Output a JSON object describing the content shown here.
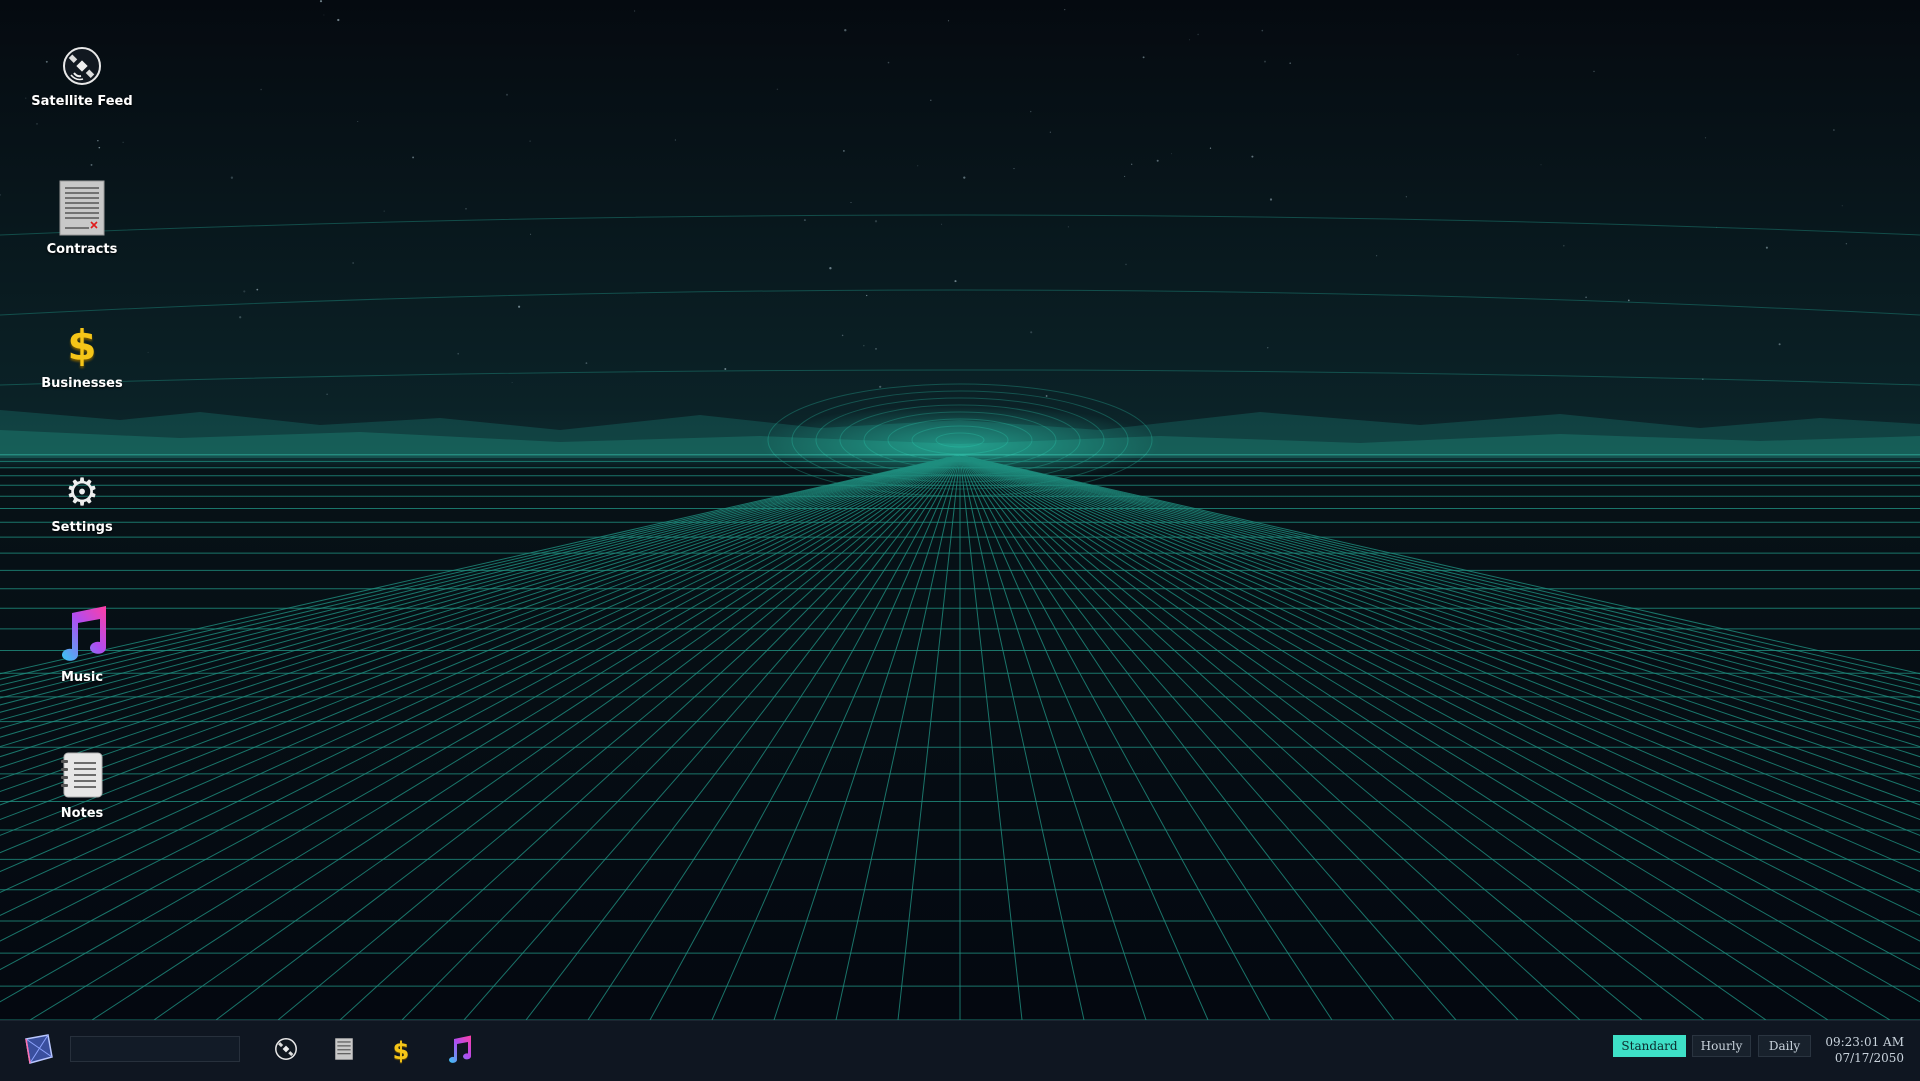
{
  "desktop": {
    "icons": [
      {
        "label": "Satellite Feed",
        "icon": "satellite-icon"
      },
      {
        "label": "Contracts",
        "icon": "contract-document-icon"
      },
      {
        "label": "Businesses",
        "icon": "dollar-sign-icon"
      },
      {
        "label": "Settings",
        "icon": "gear-icon"
      },
      {
        "label": "Music",
        "icon": "music-note-icon"
      },
      {
        "label": "Notes",
        "icon": "notebook-icon"
      }
    ]
  },
  "taskbar": {
    "start_icon": "cube-logo-icon",
    "search": {
      "value": "",
      "placeholder": ""
    },
    "pinned": [
      {
        "icon": "satellite-icon"
      },
      {
        "icon": "contract-document-icon"
      },
      {
        "icon": "dollar-sign-icon"
      },
      {
        "icon": "music-note-icon"
      }
    ],
    "time_speed": {
      "options": [
        "Standard",
        "Hourly",
        "Daily"
      ],
      "selected": "Standard"
    },
    "clock": {
      "time": "09:23:01 AM",
      "date": "07/17/2050"
    }
  },
  "colors": {
    "accent": "#3ee0c7",
    "background": "#05090f",
    "grid": "#1f8f80",
    "taskbar": "#0f1621",
    "dollar": "#f5c518",
    "music_gradient_start": "#37c8f5",
    "music_gradient_end": "#ff3fa4"
  }
}
